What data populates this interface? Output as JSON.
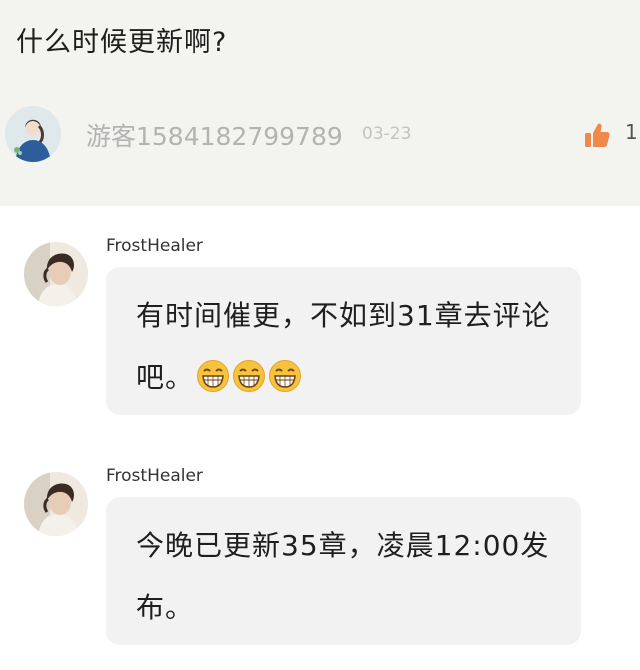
{
  "post": {
    "question": "什么时候更新啊?",
    "author": "游客1584182799789",
    "date": "03-23",
    "like_count": "1"
  },
  "replies": [
    {
      "username": "FrostHealer",
      "text": "有时间催更，不如到31章去评论吧。",
      "emojis": [
        "grinning-emoji",
        "grinning-emoji",
        "grinning-emoji"
      ]
    },
    {
      "username": "FrostHealer",
      "text": "今晚已更新35章，凌晨12:00发布。",
      "emojis": []
    }
  ],
  "colors": {
    "post_background": "#f3f4ef",
    "bubble_background": "#f2f2f2",
    "like_orange": "#f08a4b",
    "muted_text": "#b3b3b3"
  }
}
